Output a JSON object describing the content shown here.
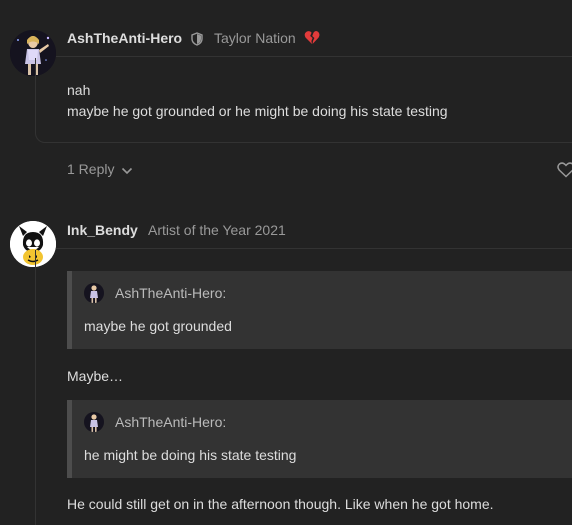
{
  "post1": {
    "username": "AshTheAnti-Hero",
    "user_title": "Taylor Nation",
    "lines": [
      "nah",
      "maybe he got grounded or he might be doing his state testing"
    ],
    "replies_label": "1 Reply"
  },
  "post2": {
    "username": "Ink_Bendy",
    "user_title": "Artist of the Year 2021",
    "quote1": {
      "author": "AshTheAnti-Hero:",
      "text": "maybe he got grounded"
    },
    "text1": "Maybe…",
    "quote2": {
      "author": "AshTheAnti-Hero:",
      "text": "he might be doing his state testing"
    },
    "text2": "He could still get on in the afternoon though. Like when he got home."
  },
  "colors": {
    "background": "#222222",
    "quote_background": "#333333",
    "broken_heart": "#e23b3b",
    "bendy_yellow": "#f2c430"
  },
  "icons": {
    "shield": "shield-icon",
    "broken_heart": "broken-heart-icon",
    "chevron": "chevron-down-icon",
    "like": "heart-outline-icon"
  }
}
